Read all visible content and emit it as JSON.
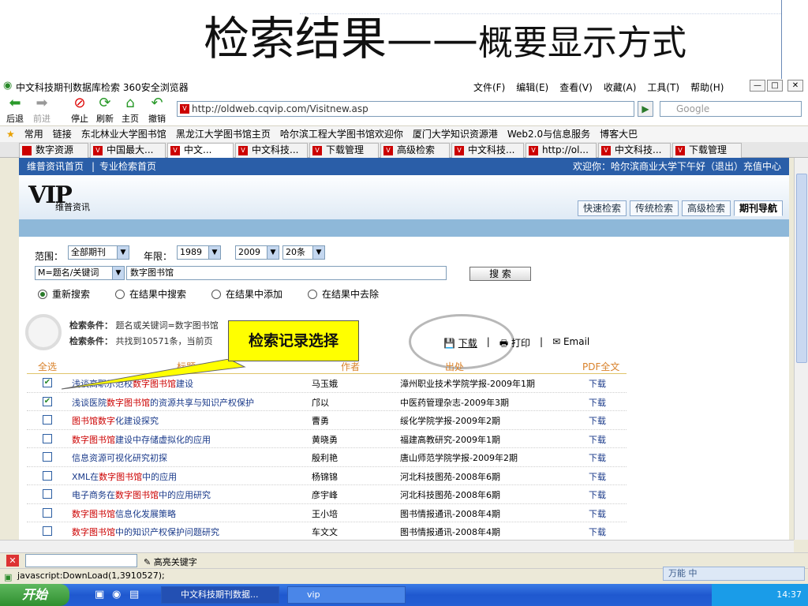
{
  "slide": {
    "title_main": "检索结果",
    "title_dash": "——",
    "title_sub": "概要显示方式"
  },
  "window": {
    "title": "中文科技期刊数据库检索   360安全浏览器",
    "menus": [
      "文件(F)",
      "编辑(E)",
      "查看(V)",
      "收藏(A)",
      "工具(T)",
      "帮助(H)"
    ]
  },
  "toolbar": {
    "buttons": [
      {
        "label": "后退",
        "icon": "back-arrow-icon"
      },
      {
        "label": "前进",
        "icon": "forward-arrow-icon"
      },
      {
        "label": "停止",
        "icon": "stop-icon"
      },
      {
        "label": "刷新",
        "icon": "refresh-icon"
      },
      {
        "label": "主页",
        "icon": "home-icon"
      },
      {
        "label": "撤销",
        "icon": "undo-icon"
      }
    ],
    "address": "http://oldweb.cqvip.com/Visitnew.asp",
    "search_placeholder": "Google"
  },
  "bookmarks": [
    "常用",
    "链接",
    "东北林业大学图书馆",
    "黑龙江大学图书馆主页",
    "哈尔滨工程大学图书馆欢迎你",
    "厦门大学知识资源港",
    "Web2.0与信息服务",
    "博客大巴"
  ],
  "tabs": [
    "数字资源",
    "中国最大...",
    "中文...",
    "中文科技...",
    "下载管理",
    "高级检索",
    "中文科技...",
    "http://ol...",
    "中文科技...",
    "下载管理"
  ],
  "site": {
    "top_links": [
      "维普资讯首页",
      "专业检索首页"
    ],
    "welcome": "欢迎你：哈尔滨商业大学下午好（退出）充值中心",
    "logo": "VIP",
    "logo_sub": "维普资讯",
    "nav": [
      "快速检索",
      "传统检索",
      "高级检索",
      "期刊导航"
    ]
  },
  "form": {
    "scope_label": "范围：",
    "scope_value": "全部期刊",
    "year_label": "年限：",
    "year_from": "1989",
    "year_to": "2009",
    "per_page": "20条",
    "field": "M=题名/关键词",
    "query": "数字图书馆",
    "search_button": "搜  索",
    "radios": [
      "重新搜索",
      "在结果中搜索",
      "在结果中添加",
      "在结果中去除"
    ]
  },
  "info": {
    "cond_label": "检索条件：",
    "cond_value": "题名或关键词=数字图书馆",
    "count_label": "检索条件：",
    "count_value": "共找到10571条，当前页",
    "callout": "检索记录选择",
    "download": "下载",
    "print": "打印",
    "email": "Email"
  },
  "table": {
    "headers": {
      "select_all": "全选",
      "title": "标题",
      "author": "作者",
      "source": "出处",
      "pdf": "PDF全文"
    },
    "rows": [
      {
        "checked": true,
        "pre": "浅谈高职示范校",
        "hl": "数字图书馆",
        "post": "建设",
        "author": "马玉娥",
        "source": "漳州职业技术学院学报-2009年1期",
        "dl": "下载"
      },
      {
        "checked": true,
        "pre": "浅谈医院",
        "hl": "数字图书馆",
        "post": "的资源共享与知识产权保护",
        "author": "邝以",
        "source": "中医药管理杂志-2009年3期",
        "dl": "下载"
      },
      {
        "checked": false,
        "pre": "",
        "hl": "图书馆数字",
        "post": "化建设探究",
        "author": "曹勇",
        "source": "绥化学院学报-2009年2期",
        "dl": "下载"
      },
      {
        "checked": false,
        "pre": "",
        "hl": "数字图书馆",
        "post": "建设中存储虚拟化的应用",
        "author": "黄晓勇",
        "source": "福建高教研究-2009年1期",
        "dl": "下载"
      },
      {
        "checked": false,
        "pre": "信息资源可视化研究初探",
        "hl": "",
        "post": "",
        "author": "殷利艳",
        "source": "唐山师范学院学报-2009年2期",
        "dl": "下载"
      },
      {
        "checked": false,
        "pre": "XML在",
        "hl": "数字图书馆",
        "post": "中的应用",
        "author": "杨锦锦",
        "source": "河北科技图苑-2008年6期",
        "dl": "下载"
      },
      {
        "checked": false,
        "pre": "电子商务在",
        "hl": "数字图书馆",
        "post": "中的应用研究",
        "author": "彦宇峰",
        "source": "河北科技图苑-2008年6期",
        "dl": "下载"
      },
      {
        "checked": false,
        "pre": "",
        "hl": "数字图书馆",
        "post": "信息化发展策略",
        "author": "王小培",
        "source": "图书情报通讯-2008年4期",
        "dl": "下载"
      },
      {
        "checked": false,
        "pre": "",
        "hl": "数字图书馆",
        "post": "中的知识产权保护问题研究",
        "author": "车文文",
        "source": "图书情报通讯-2008年4期",
        "dl": "下载"
      }
    ]
  },
  "findbar": {
    "label": "高亮关键字"
  },
  "status": {
    "text": "javascript:DownLoad(1,3910527);"
  },
  "ime": {
    "text": "万能 中"
  },
  "taskbar": {
    "start": "开始",
    "tasks": [
      "中文科技期刊数据...",
      "vip"
    ],
    "clock": "14:37"
  }
}
